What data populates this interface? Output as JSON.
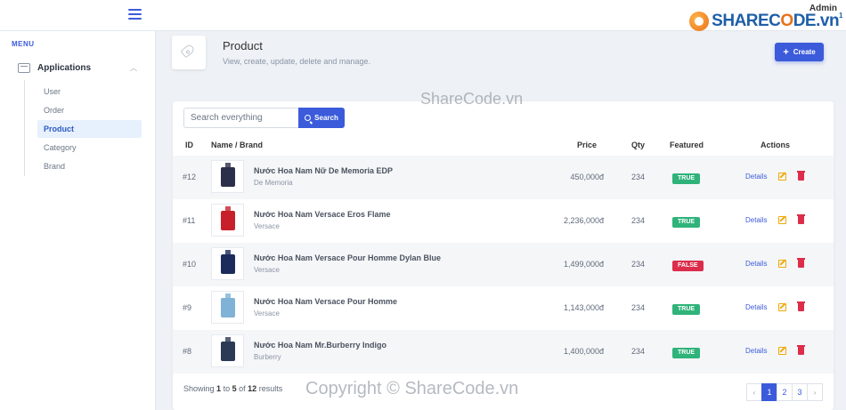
{
  "topbar": {
    "admin_label": "Admin",
    "logo_text_a": "SHAREC",
    "logo_text_o": "O",
    "logo_text_b": "DE",
    "logo_text_c": ".vn",
    "logo_superscript": "1",
    "menu_icon": "hamburger-icon"
  },
  "sidebar": {
    "heading": "MENU",
    "group": {
      "label": "Applications",
      "icon": "box-icon",
      "chevron": "chevron-up-icon"
    },
    "items": [
      {
        "label": "User",
        "active": false
      },
      {
        "label": "Order",
        "active": false
      },
      {
        "label": "Product",
        "active": true
      },
      {
        "label": "Category",
        "active": false
      },
      {
        "label": "Brand",
        "active": false
      }
    ]
  },
  "header": {
    "icon": "tag-icon",
    "title": "Product",
    "subtitle": "View, create, update, delete and manage.",
    "create_label": "Create"
  },
  "search": {
    "placeholder": "Search everything",
    "button_label": "Search"
  },
  "table": {
    "columns": [
      "ID",
      "Name / Brand",
      "Price",
      "Qty",
      "Featured",
      "Actions"
    ],
    "rows": [
      {
        "id": "#12",
        "name": "Nước Hoa Nam Nữ De Memoria EDP",
        "brand": "De Memoria",
        "price": "450,000đ",
        "qty": "234",
        "featured": "TRUE",
        "details": "Details",
        "thumb_color": "#2c2f4a"
      },
      {
        "id": "#11",
        "name": "Nước Hoa Nam Versace Eros Flame",
        "brand": "Versace",
        "price": "2,236,000đ",
        "qty": "234",
        "featured": "TRUE",
        "details": "Details",
        "thumb_color": "#c8202a"
      },
      {
        "id": "#10",
        "name": "Nước Hoa Nam Versace Pour Homme Dylan Blue",
        "brand": "Versace",
        "price": "1,499,000đ",
        "qty": "234",
        "featured": "FALSE",
        "details": "Details",
        "thumb_color": "#1b2c5c"
      },
      {
        "id": "#9",
        "name": "Nước Hoa Nam Versace Pour Homme",
        "brand": "Versace",
        "price": "1,143,000đ",
        "qty": "234",
        "featured": "TRUE",
        "details": "Details",
        "thumb_color": "#7fb2d6"
      },
      {
        "id": "#8",
        "name": "Nước Hoa Nam Mr.Burberry Indigo",
        "brand": "Burberry",
        "price": "1,400,000đ",
        "qty": "234",
        "featured": "TRUE",
        "details": "Details",
        "thumb_color": "#2b3a55"
      }
    ]
  },
  "footer": {
    "showing_prefix": "Showing",
    "from": "1",
    "to_word": "to",
    "to": "5",
    "of_word": "of",
    "total": "12",
    "suffix": "results"
  },
  "pagination": {
    "prev": "‹",
    "pages": [
      "1",
      "2",
      "3"
    ],
    "active_page": "1",
    "next": "›"
  },
  "watermarks": {
    "top": "ShareCode.vn",
    "bottom": "Copyright © ShareCode.vn"
  },
  "colors": {
    "accent": "#3b5bdb",
    "true_badge": "#2fb37a",
    "false_badge": "#dc2d4a"
  }
}
